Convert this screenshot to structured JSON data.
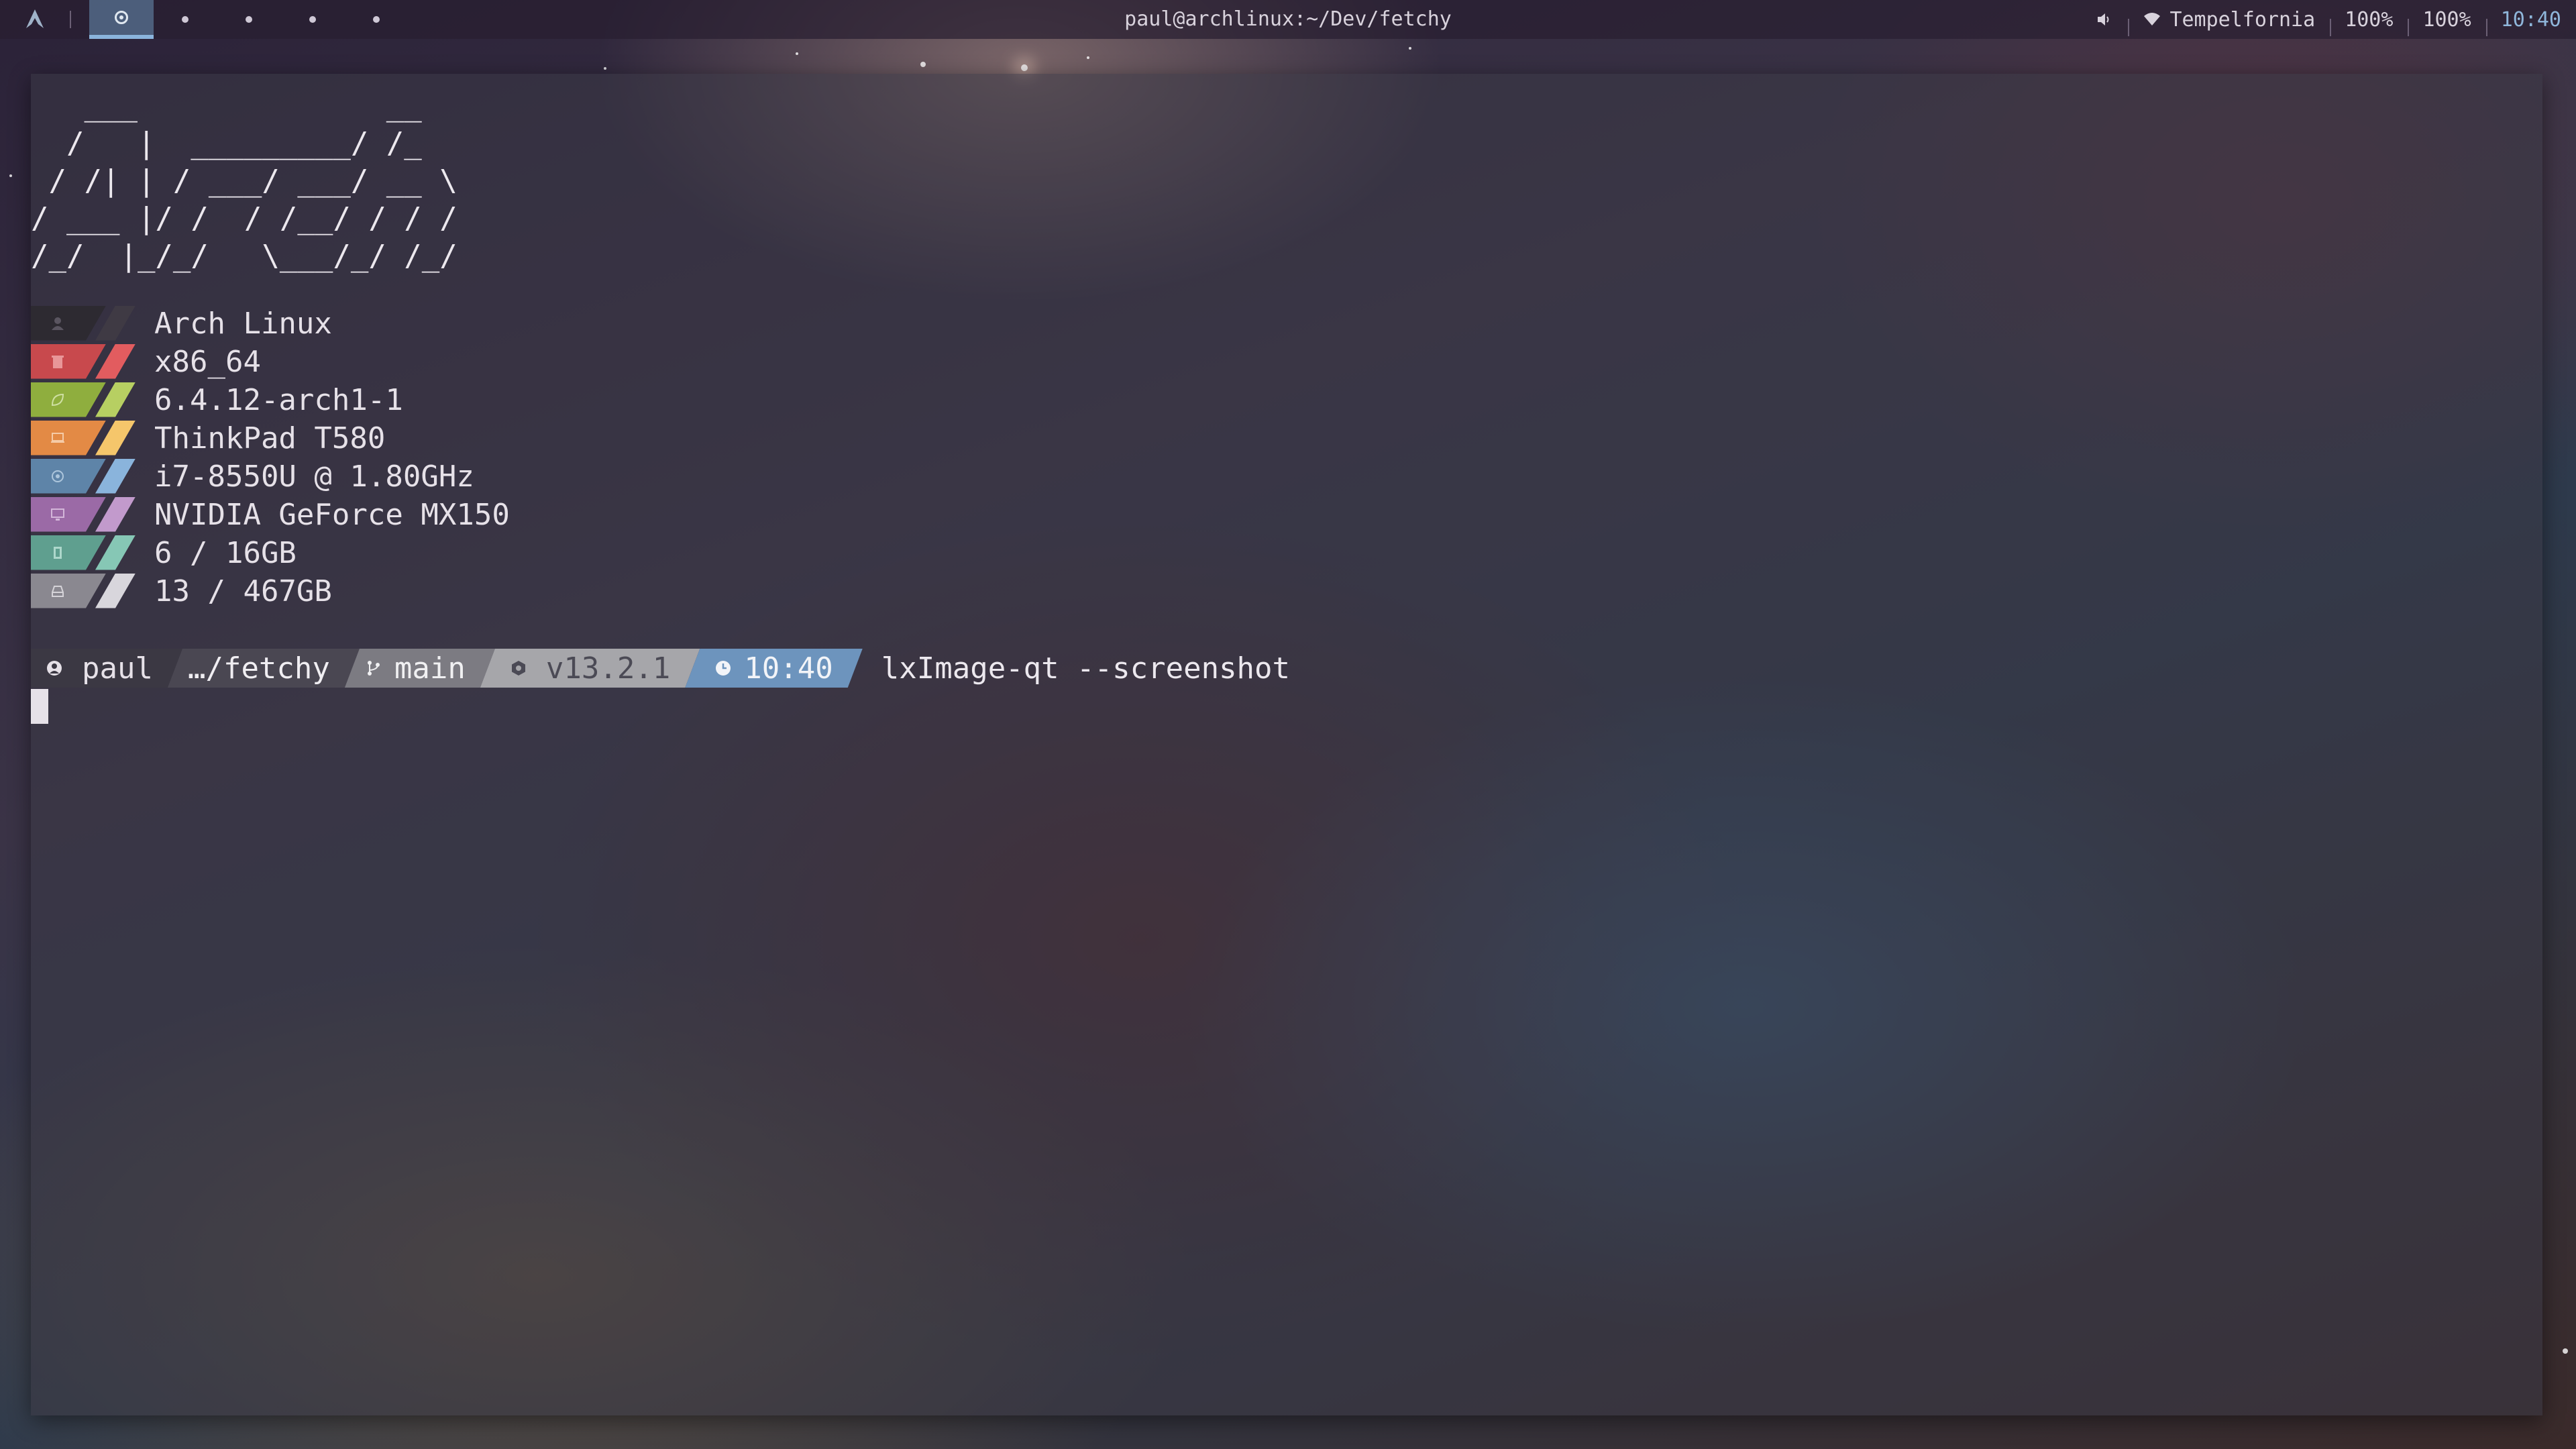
{
  "topbar": {
    "window_title": "paul@archlinux:~/Dev/fetchy",
    "network_name": "Tempelfornia",
    "battery": "100%",
    "brightness": "100%",
    "clock": "10:40",
    "workspaces": [
      "1",
      "2",
      "3",
      "4",
      "5"
    ],
    "active_workspace": 0
  },
  "terminal": {
    "ascii_art": "   ___              __\n  /   |  _________/ /_\n / /| | / ___/ ___/ __ \\\n/ ___ |/ /  / /__/ / / /\n/_/  |_/_/   \\___/_/ /_/",
    "system_info": [
      {
        "icon": "user-icon",
        "value": "Arch Linux",
        "color": "#2d2a31",
        "accent": "#3f3a44"
      },
      {
        "icon": "trash-icon",
        "value": "x86_64",
        "color": "#c8494d",
        "accent": "#e25c5f"
      },
      {
        "icon": "leaf-icon",
        "value": "6.4.12-arch1-1",
        "color": "#8fae3e",
        "accent": "#b7cf62"
      },
      {
        "icon": "laptop-icon",
        "value": "ThinkPad T580",
        "color": "#e38a45",
        "accent": "#f5c66b"
      },
      {
        "icon": "cpu-icon",
        "value": "i7-8550U @ 1.80GHz",
        "color": "#5e84a8",
        "accent": "#8ab4dc"
      },
      {
        "icon": "monitor-icon",
        "value": "NVIDIA GeForce MX150",
        "color": "#9b6aa6",
        "accent": "#c29acc"
      },
      {
        "icon": "memory-icon",
        "value": "6 / 16GB",
        "color": "#5f9f8f",
        "accent": "#86c7b5"
      },
      {
        "icon": "disk-icon",
        "value": "13 / 467GB",
        "color": "#8a8890",
        "accent": "#d8d6dc"
      }
    ],
    "prompt": {
      "user": "paul",
      "path": "…/fetchy",
      "branch": "main",
      "node_version": "v13.2.1",
      "time": "10:40",
      "command": "lxImage-qt --screenshot"
    }
  }
}
